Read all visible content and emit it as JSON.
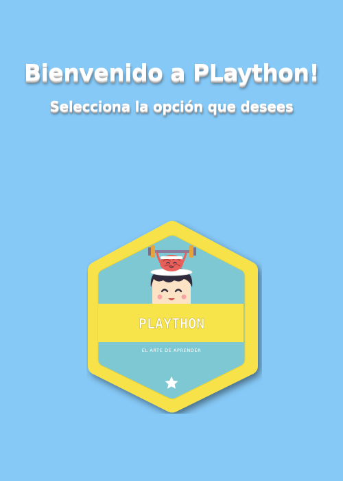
{
  "header": {
    "title": "Bienvenido a PLaython!",
    "subtitle": "Selecciona la opción que desees"
  },
  "badge": {
    "name": "PLAYTHON",
    "tagline": "EL ARTE DE APRENDER",
    "icons": [
      "brain-lifting-weights-icon",
      "boy-face-icon",
      "star-icon"
    ]
  },
  "colors": {
    "background": "#86c9f7",
    "badge_border": "#f7e34a",
    "badge_fill": "#7ec8d3",
    "ribbon": "#f7e34a"
  }
}
